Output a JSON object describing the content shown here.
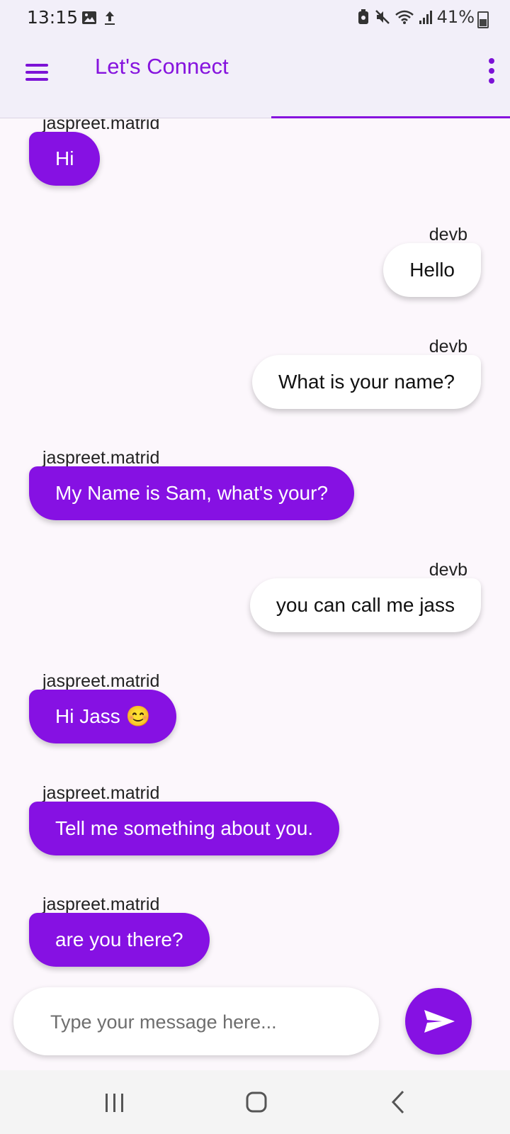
{
  "status_bar": {
    "time": "13:15",
    "battery": "41%",
    "icons": [
      "image-icon",
      "upload-icon",
      "battery-saver-icon",
      "mute-icon",
      "wifi-icon",
      "signal-icon",
      "battery-icon"
    ]
  },
  "app_bar": {
    "title": "Let's Connect",
    "accent_color": "#8613de"
  },
  "messages": [
    {
      "sender": "jaspreet.matrid",
      "text": "Hi",
      "direction": "incoming"
    },
    {
      "sender": "devb",
      "text": "Hello",
      "direction": "outgoing"
    },
    {
      "sender": "devb",
      "text": "What is your name?",
      "direction": "outgoing"
    },
    {
      "sender": "jaspreet.matrid",
      "text": "My Name is Sam, what's your?",
      "direction": "incoming"
    },
    {
      "sender": "devb",
      "text": "you can call me jass",
      "direction": "outgoing"
    },
    {
      "sender": "jaspreet.matrid",
      "text": "Hi Jass 😊",
      "direction": "incoming"
    },
    {
      "sender": "jaspreet.matrid",
      "text": "Tell me something about you.",
      "direction": "incoming"
    },
    {
      "sender": "jaspreet.matrid",
      "text": "are you there?",
      "direction": "incoming"
    }
  ],
  "composer": {
    "placeholder": "Type your message here...",
    "value": ""
  },
  "colors": {
    "incoming_bubble": "#8611e3",
    "outgoing_bubble": "#ffffff",
    "background": "#fcf7fc"
  }
}
